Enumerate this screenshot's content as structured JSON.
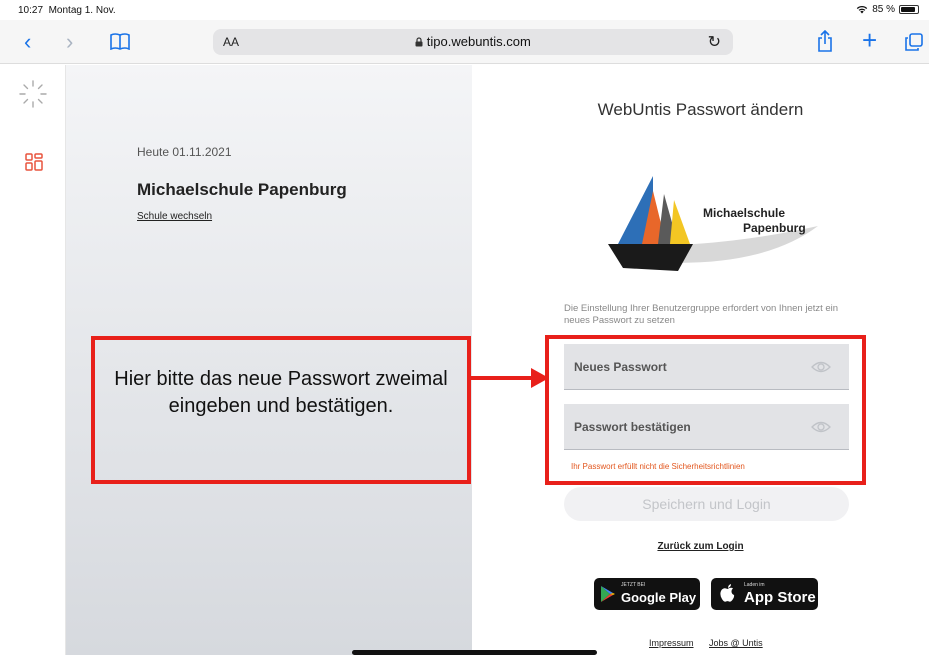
{
  "status_bar": {
    "time": "10:27",
    "date": "Montag 1. Nov.",
    "battery": "85 %",
    "battery_fraction": 0.85
  },
  "browser": {
    "text_size_label": "AA",
    "url": "tipo.webuntis.com",
    "icons": [
      "back-icon",
      "forward-icon",
      "bookmarks-icon",
      "lock-icon",
      "reload-icon",
      "share-icon",
      "new-tab-icon",
      "tabs-icon"
    ]
  },
  "sidebar": {
    "icons": [
      "loading-spinner-icon",
      "dashboard-grid-icon"
    ],
    "accent": "#e8533d"
  },
  "school_panel": {
    "today": "Heute 01.11.2021",
    "school_name": "Michaelschule Papenburg",
    "switch_link": "Schule wechseln"
  },
  "form": {
    "title": "WebUntis Passwort ändern",
    "logo_line1": "Michaelschule",
    "logo_line2": "Papenburg",
    "info": "Die Einstellung Ihrer Benutzergruppe erfordert von Ihnen jetzt ein neues Passwort zu setzen",
    "new_password_label": "Neues Passwort",
    "confirm_password_label": "Passwort bestätigen",
    "error": "Ihr Passwort erfüllt nicht die Sicherheitsrichtlinien",
    "save_button": "Speichern und Login",
    "back_link": "Zurück zum Login"
  },
  "stores": {
    "google_small": "JETZT BEI",
    "google_big": "Google Play",
    "apple_small": "Laden im",
    "apple_big": "App Store"
  },
  "footer": {
    "impressum": "Impressum",
    "jobs": "Jobs @ Untis"
  },
  "annotation": {
    "text": "Hier bitte das neue Passwort zweimal eingeben und bestätigen.",
    "color": "#e8201a"
  },
  "colors": {
    "error": "#e2561e",
    "link_blue": "#1a73e8"
  }
}
